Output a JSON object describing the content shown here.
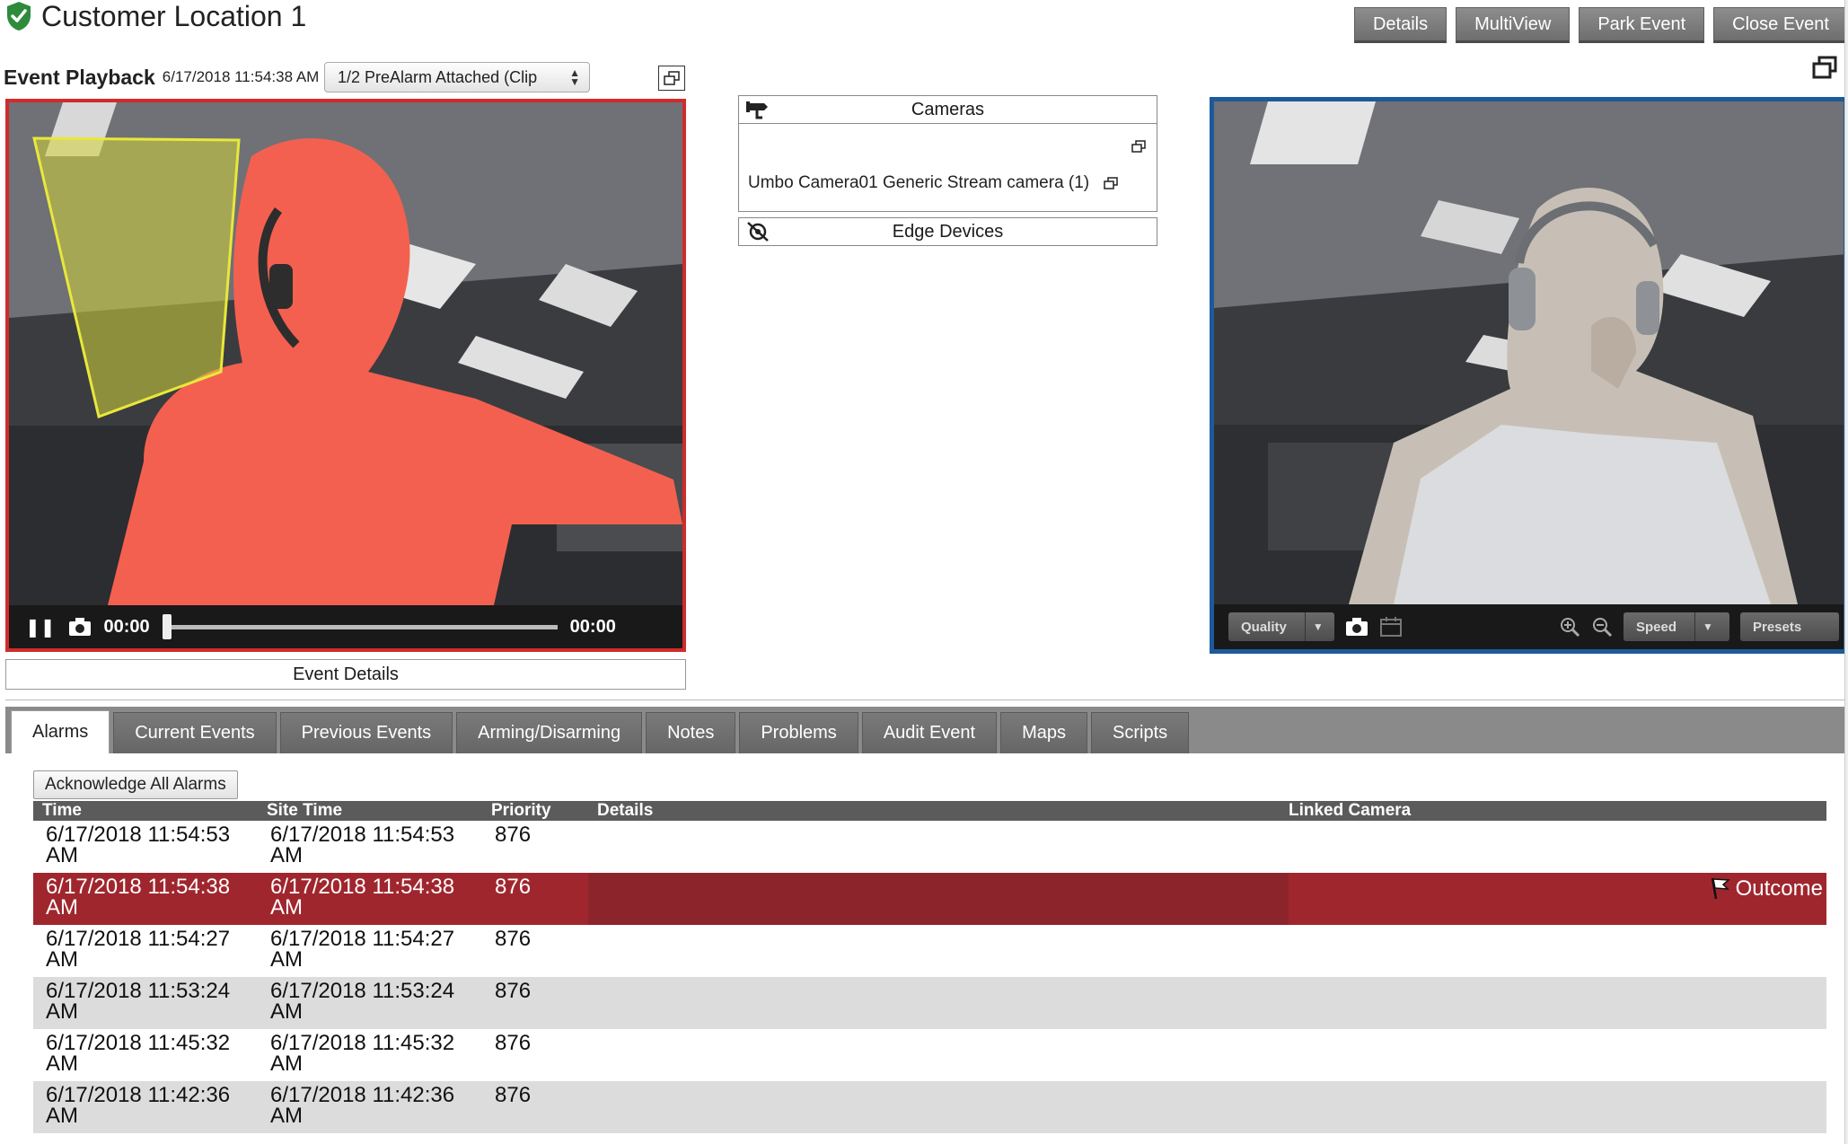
{
  "header": {
    "title": "Customer Location 1",
    "buttons": [
      "Details",
      "MultiView",
      "Park Event",
      "Close Event"
    ]
  },
  "playback": {
    "label": "Event Playback",
    "timestamp": "6/17/2018 11:54:38 AM",
    "clip_select": "1/2 PreAlarm Attached (Clip",
    "time_current": "00:00",
    "time_total": "00:00",
    "progress": 0
  },
  "cameras_panel": {
    "cameras_label": "Cameras",
    "camera_items": [
      "Umbo Camera01 Generic Stream camera (1)"
    ],
    "edge_devices_label": "Edge Devices"
  },
  "live_controls": {
    "quality": "Quality",
    "speed": "Speed",
    "presets": "Presets"
  },
  "event_details_label": "Event Details",
  "tabs": [
    "Alarms",
    "Current Events",
    "Previous Events",
    "Arming/Disarming",
    "Notes",
    "Problems",
    "Audit Event",
    "Maps",
    "Scripts"
  ],
  "alarms": {
    "ack_button": "Acknowledge All Alarms",
    "columns": [
      "Time",
      "Site Time",
      "Priority",
      "Details",
      "Linked Camera"
    ],
    "rows": [
      {
        "time": "6/17/2018 11:54:53 AM",
        "site_time": "6/17/2018 11:54:53 AM",
        "priority": "876",
        "details": "",
        "linked": "",
        "outcome": ""
      },
      {
        "time": "6/17/2018 11:54:38 AM",
        "site_time": "6/17/2018 11:54:38 AM",
        "priority": "876",
        "details": "",
        "linked": "",
        "outcome": "Outcome"
      },
      {
        "time": "6/17/2018 11:54:27 AM",
        "site_time": "6/17/2018 11:54:27 AM",
        "priority": "876",
        "details": "",
        "linked": "",
        "outcome": ""
      },
      {
        "time": "6/17/2018 11:53:24 AM",
        "site_time": "6/17/2018 11:53:24 AM",
        "priority": "876",
        "details": "",
        "linked": "",
        "outcome": ""
      },
      {
        "time": "6/17/2018 11:45:32 AM",
        "site_time": "6/17/2018 11:45:32 AM",
        "priority": "876",
        "details": "",
        "linked": "",
        "outcome": ""
      },
      {
        "time": "6/17/2018 11:42:36 AM",
        "site_time": "6/17/2018 11:42:36 AM",
        "priority": "876",
        "details": "",
        "linked": "",
        "outcome": ""
      }
    ]
  },
  "colors": {
    "alarm_border": "#d12b2b",
    "live_border": "#1d5a9a",
    "selected_row": "#a0262e",
    "header_gray": "#5b5b5b",
    "shield_green": "#2e8b3c"
  }
}
